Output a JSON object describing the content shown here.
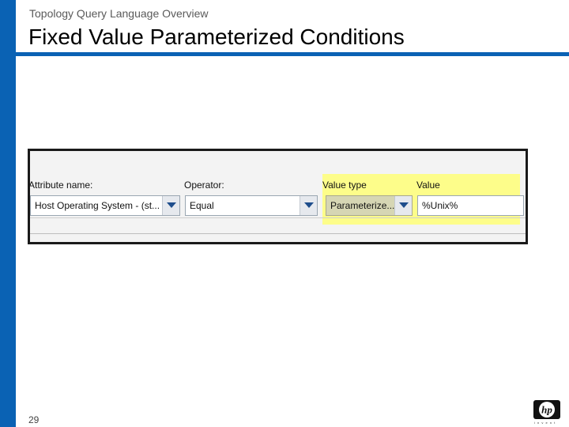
{
  "slide": {
    "subtitle": "Topology Query Language Overview",
    "title": "Fixed Value Parameterized Conditions",
    "page_number": "29"
  },
  "condition_row": {
    "attribute_label": "Attribute name:",
    "attribute_value": "Host Operating System - (st...",
    "operator_label": "Operator:",
    "operator_value": "Equal",
    "value_type_label": "Value type",
    "value_type_value": "Parameterize...",
    "value_label": "Value",
    "value_value": "%Unix%"
  },
  "logo": {
    "text": "hp",
    "tagline": "i n v e n t"
  },
  "colors": {
    "accent_blue": "#0a62b4",
    "highlight_yellow": "#fdfd8a"
  }
}
